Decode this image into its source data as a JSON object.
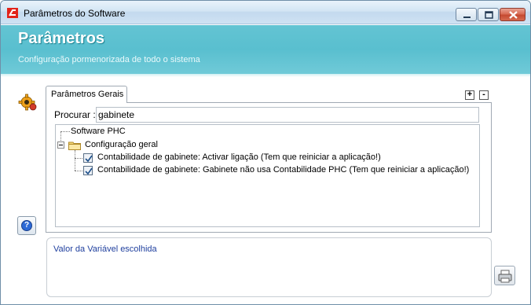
{
  "window": {
    "title": "Parâmetros do Software"
  },
  "banner": {
    "title": "Parâmetros",
    "subtitle": "Configuração pormenorizada de todo o sistema"
  },
  "tabs": [
    {
      "label": "Parâmetros Gerais",
      "selected": true
    }
  ],
  "expand_controls": {
    "expand": "+",
    "collapse": "-"
  },
  "search": {
    "label": "Procurar :",
    "value": "gabinete"
  },
  "tree": {
    "root": "Software PHC",
    "group": "Configuração geral",
    "items": [
      {
        "label": "Contabilidade de gabinete: Activar ligação (Tem que reiniciar a aplicação!)",
        "checked": true
      },
      {
        "label": "Contabilidade de gabinete: Gabinete não usa Contabilidade PHC (Tem que reiniciar a aplicação!)",
        "checked": true
      }
    ]
  },
  "value_panel": {
    "label": "Valor da Variável escolhida"
  },
  "colors": {
    "banner": "#5cc0d0",
    "value_label": "#1f3f9e"
  },
  "icons": {
    "app": "phc-logo-icon",
    "gear": "gear-icon",
    "help": "help-icon",
    "print": "printer-icon"
  }
}
